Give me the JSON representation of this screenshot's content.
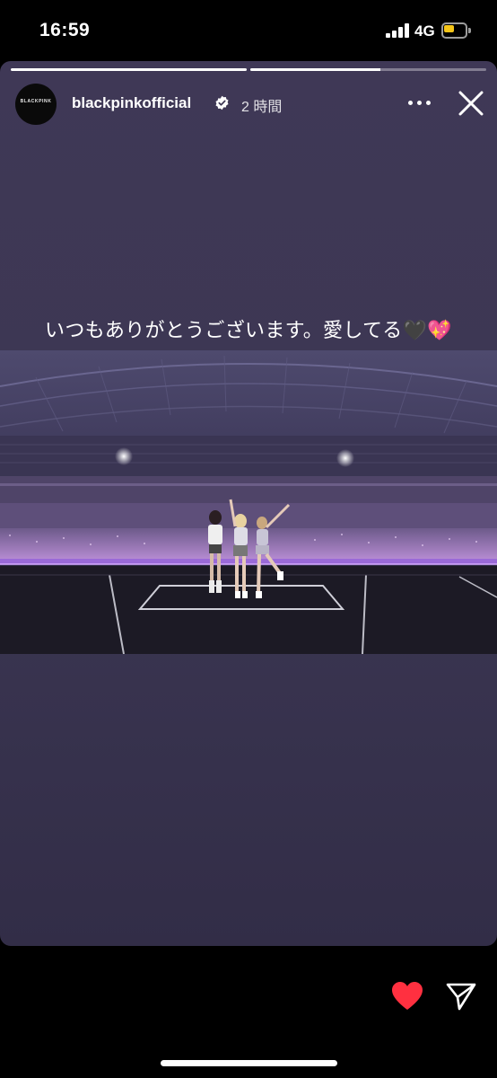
{
  "status_bar": {
    "time": "16:59",
    "network": "4G",
    "battery_color": "#f5c518"
  },
  "story": {
    "progress": [
      1.0,
      0.55
    ],
    "account": {
      "avatar_text": "BLACKPINK",
      "username": "blackpinkofficial",
      "verified": true,
      "time_ago": "2 時間"
    },
    "caption": "いつもありがとうございます。愛してる🖤💖",
    "photo": {
      "alt": "stage photo"
    },
    "icons": {
      "more": "more-options-icon",
      "close": "close-icon",
      "like": "heart-icon",
      "share": "send-icon",
      "verified": "verified-badge-icon"
    },
    "colors": {
      "background": "#3d3754",
      "like": "#ff3040"
    }
  }
}
